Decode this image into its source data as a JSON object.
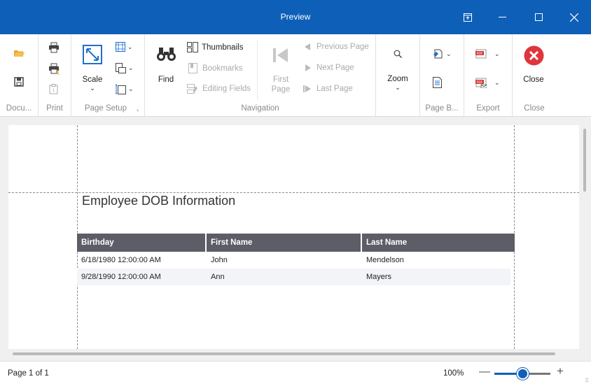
{
  "window": {
    "title": "Preview"
  },
  "ribbon": {
    "groups": {
      "document": "Docu...",
      "print": "Print",
      "page_setup": "Page Setup",
      "navigation": "Navigation",
      "zoom": "",
      "page_background": "Page B...",
      "export": "Export",
      "close": "Close"
    },
    "buttons": {
      "scale": "Scale",
      "find": "Find",
      "thumbnails": "Thumbnails",
      "bookmarks": "Bookmarks",
      "editing_fields": "Editing Fields",
      "first_page_line1": "First",
      "first_page_line2": "Page",
      "previous_page": "Previous Page",
      "next_page": "Next  Page",
      "last_page": "Last  Page",
      "zoom": "Zoom",
      "close": "Close"
    }
  },
  "report": {
    "title": "Employee DOB Information",
    "columns": [
      "Birthday",
      "First Name",
      "Last Name"
    ],
    "rows": [
      [
        "6/18/1980 12:00:00 AM",
        "John",
        "Mendelson"
      ],
      [
        "9/28/1990 12:00:00 AM",
        "Ann",
        "Mayers"
      ]
    ]
  },
  "status": {
    "page_info": "Page 1 of 1",
    "zoom_level": "100%",
    "zoom_fraction": 0.5
  },
  "colors": {
    "titlebar": "#0e5fb8",
    "table_header": "#5c5d66",
    "close_red": "#e0353d",
    "pdf_red": "#d43a3a"
  }
}
